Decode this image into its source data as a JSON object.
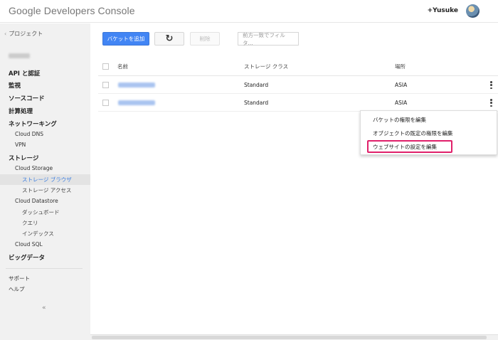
{
  "header": {
    "logo_google": "Google",
    "logo_rest": " Developers Console",
    "user": "+Yusuke"
  },
  "sidebar": {
    "back": "プロジェクト",
    "items": {
      "api": "API と認証",
      "monitoring": "監視",
      "source": "ソースコード",
      "compute": "計算処理",
      "networking": "ネットワーキング",
      "cloud_dns": "Cloud DNS",
      "vpn": "VPN",
      "storage": "ストレージ",
      "cloud_storage": "Cloud Storage",
      "storage_browser": "ストレージ ブラウザ",
      "storage_access": "ストレージ アクセス",
      "cloud_datastore": "Cloud Datastore",
      "dashboard": "ダッシュボード",
      "query": "クエリ",
      "indexes": "インデックス",
      "cloud_sql": "Cloud SQL",
      "bigdata": "ビッグデータ"
    },
    "support": "サポート",
    "help": "ヘルプ",
    "collapse": "«"
  },
  "toolbar": {
    "add_bucket": "バケットを追加",
    "refresh_icon": "↻",
    "delete": "削除",
    "filter_placeholder": "前方一致でフィルタ..."
  },
  "table": {
    "headers": [
      "名前",
      "ストレージ クラス",
      "場所"
    ],
    "rows": [
      {
        "storage_class": "Standard",
        "location": "ASIA"
      },
      {
        "storage_class": "Standard",
        "location": "ASIA"
      }
    ]
  },
  "menu": {
    "items": [
      "バケットの権限を編集",
      "オブジェクトの既定の権限を編集",
      "ウェブサイトの設定を編集"
    ]
  },
  "colors": {
    "accent": "#4285f4",
    "highlight": "#e0206a",
    "active_nav": "#3a7de0"
  }
}
